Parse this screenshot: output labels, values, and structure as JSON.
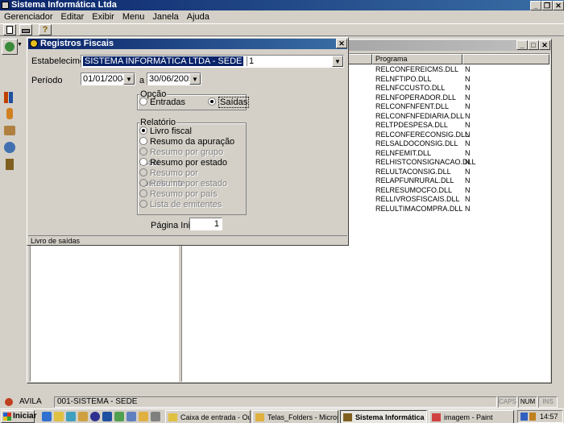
{
  "app": {
    "title": "Sistema Informática Ltda"
  },
  "menu": [
    "Gerenciador",
    "Editar",
    "Exibir",
    "Menu",
    "Janela",
    "Ajuda"
  ],
  "programs": {
    "column": "Programa",
    "rows": [
      {
        "name": "RELCONFEREICMS.DLL",
        "flag": "N"
      },
      {
        "name": "RELNFTIPO.DLL",
        "flag": "N"
      },
      {
        "name": "RELNFCCUSTO.DLL",
        "flag": "N"
      },
      {
        "name": "RELNFOPERADOR.DLL",
        "flag": "N"
      },
      {
        "name": "RELCONFNFENT.DLL",
        "flag": "N"
      },
      {
        "name": "RELCONFNFEDIARIA.DLL",
        "flag": "N"
      },
      {
        "name": "RELTPDESPESA.DLL",
        "flag": "N"
      },
      {
        "name": "RELCONFERECONSIG.DLL",
        "flag": "N"
      },
      {
        "name": "RELSALDOCONSIG.DLL",
        "flag": "N"
      },
      {
        "name": "RELNFEMIT.DLL",
        "flag": "N"
      },
      {
        "name": "RELHISTCONSIGNACAO.DLL",
        "flag": "N"
      },
      {
        "name": "RELULTACONSIG.DLL",
        "flag": "N"
      },
      {
        "name": "RELAPFUNRURAL.DLL",
        "flag": "N"
      },
      {
        "name": "RELRESUMOCFO.DLL",
        "flag": "N"
      },
      {
        "name": "RELLIVROSFISCAIS.DLL",
        "flag": "N"
      },
      {
        "name": "RELULTIMACOMPRA.DLL",
        "flag": "N"
      }
    ]
  },
  "dialog": {
    "title": "Registros Fiscais",
    "estabelecimento_label": "Estabelecimento",
    "estabelecimento_value": "SISTEMA INFORMÁTICA LTDA - SEDE",
    "estabelecimento_code": "1",
    "periodo_label": "Período",
    "date_from": "01/01/2004",
    "a_label": "a",
    "date_to": "30/06/2005",
    "opcao_title": "Opção",
    "opcao": {
      "entradas": "Entradas",
      "saidas": "Saídas"
    },
    "relatorio_title": "Relatório",
    "relatorio": [
      {
        "label": "Livro fiscal",
        "checked": true,
        "enabled": true
      },
      {
        "label": "Resumo da apuração",
        "checked": false,
        "enabled": true
      },
      {
        "label": "Resumo por grupo fiscal",
        "checked": false,
        "enabled": false
      },
      {
        "label": "Resumo por estado",
        "checked": false,
        "enabled": true
      },
      {
        "label": "Resumo por contribuinte",
        "checked": false,
        "enabled": false
      },
      {
        "label": "Resumo por estado",
        "checked": false,
        "enabled": false
      },
      {
        "label": "Resumo por país",
        "checked": false,
        "enabled": false
      },
      {
        "label": "Lista de emitentes",
        "checked": false,
        "enabled": false
      }
    ],
    "pagina_label": "Página Inicial",
    "pagina_value": "1",
    "status": "Livro de saídas"
  },
  "statusbar": {
    "user": "AVILA",
    "establishment": "001-SISTEMA - SEDE",
    "caps": "CAPS",
    "num": "NUM",
    "ins": "INS"
  },
  "taskbar": {
    "start": "Iniciar",
    "tasks": [
      {
        "label": "Caixa de entrada - Outl..."
      },
      {
        "label": "Telas_Folders - Microsof..."
      },
      {
        "label": "Sistema Informática ..."
      },
      {
        "label": "imagem - Paint"
      }
    ],
    "clock": "14:57"
  }
}
